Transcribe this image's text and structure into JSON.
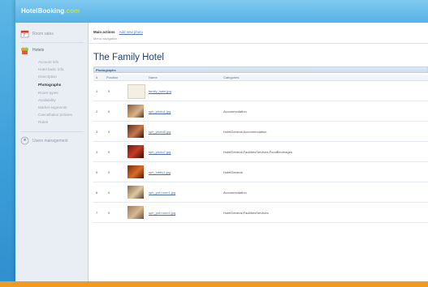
{
  "app": {
    "logo_text": "HotelBooking",
    "logo_suffix": ".com"
  },
  "sidebar": {
    "items": [
      {
        "label": "Room rates"
      },
      {
        "label": "Hotels"
      },
      {
        "label": "Users management"
      }
    ],
    "hotel_subitems": [
      "Account info",
      "Hotel basic info",
      "Description",
      "Photographs",
      "Room types",
      "Availability",
      "Market segments",
      "Cancellation policies",
      "Rates"
    ],
    "active_subitem": "Photographs"
  },
  "main": {
    "menu": {
      "label": "Main actions",
      "link": "Add new photo"
    },
    "submenu": "Menu navigation",
    "page_title": "The Family Hotel",
    "section_title": "Photographs",
    "columns": [
      "#",
      "Position",
      "Name",
      "Categories"
    ],
    "rows": [
      {
        "num": "1",
        "pos": "0",
        "name": "family_hotel.jpg",
        "categories": ""
      },
      {
        "num": "2",
        "pos": "0",
        "name": "sph_photo1.jpg",
        "categories": "Accommodation"
      },
      {
        "num": "3",
        "pos": "0",
        "name": "sph_photo5.jpg",
        "categories": "HotelGeneral;Accommodation"
      },
      {
        "num": "4",
        "pos": "0",
        "name": "sph_photo7.jpg",
        "categories": "HotelGeneral;FacilitiesServices;FoodBeverages"
      },
      {
        "num": "5",
        "pos": "0",
        "name": "sph_lobby1.jpg",
        "categories": "HotelGeneral"
      },
      {
        "num": "6",
        "pos": "0",
        "name": "sph_pot.room1.jpg",
        "categories": "Accommodation"
      },
      {
        "num": "7",
        "pos": "0",
        "name": "sph_pot.room2.jpg",
        "categories": "HotelGeneral;FacilitiesServices"
      }
    ]
  },
  "colors": {
    "accent": "#f29a1f",
    "frame": "#3a9fd8",
    "title": "#1f3f6e",
    "link": "#4a6fa5"
  }
}
